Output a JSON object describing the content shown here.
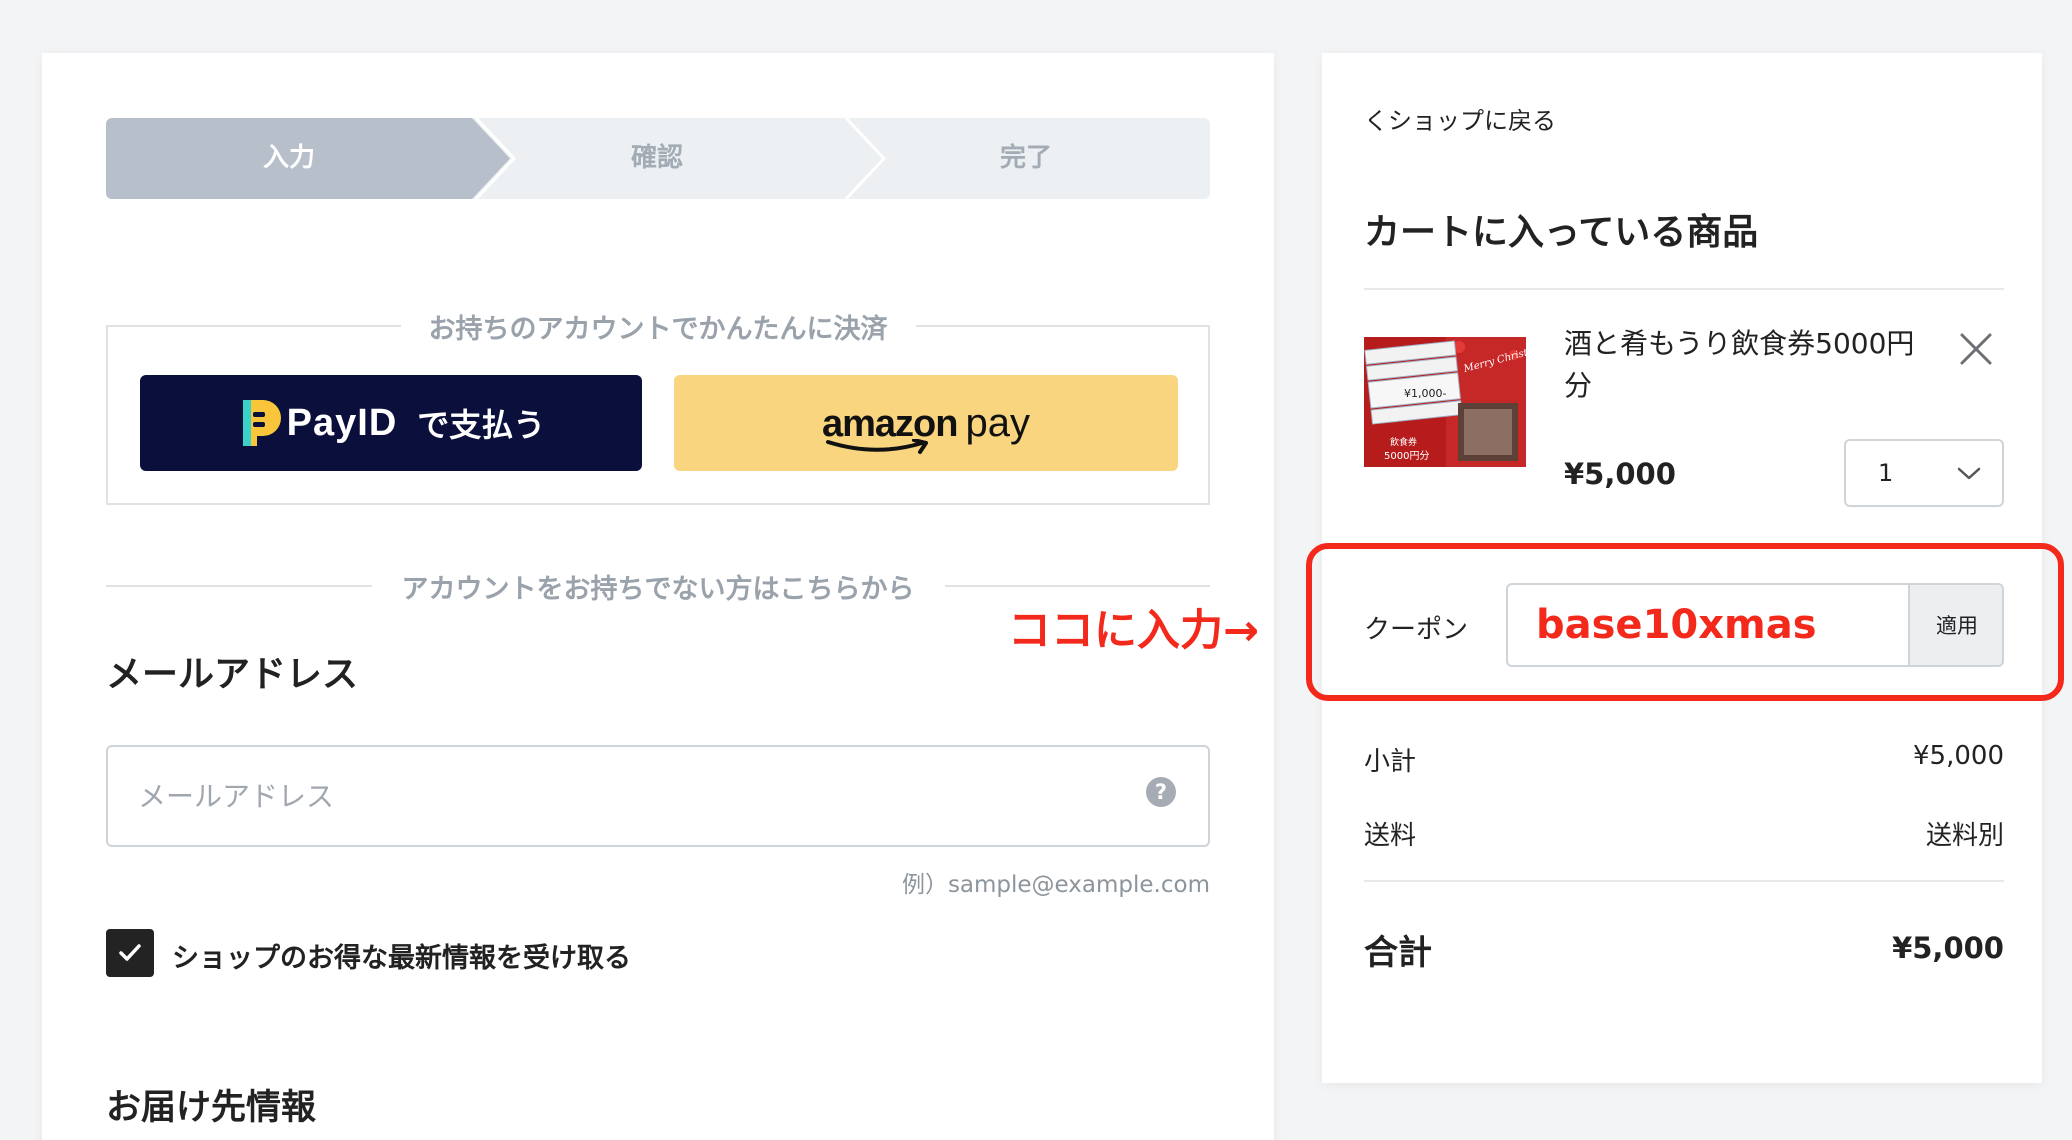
{
  "steps": [
    "入力",
    "確認",
    "完了"
  ],
  "account": {
    "legend": "お持ちのアカウントでかんたんに決済",
    "payid_brand": "PayID",
    "payid_suffix": "で支払う",
    "amazon_word": "amazon",
    "amazon_pay": "pay"
  },
  "guest": {
    "divider": "アカウントをお持ちでない方はこちらから",
    "email_label": "メールアドレス",
    "email_placeholder": "メールアドレス",
    "help_icon": "?",
    "email_example": "例）sample@example.com",
    "newsletter_label": "ショップのお得な最新情報を受け取る",
    "newsletter_checked": true,
    "delivery_label": "お届け先情報"
  },
  "annotation": "ココに入力→",
  "cart": {
    "back_link": "くショップに戻る",
    "title": "カートに入っている商品",
    "item": {
      "name": "酒と肴もうり飲食券5000円分",
      "price": "¥5,000",
      "quantity": "1",
      "image_texts": {
        "script": "Merry Christmas",
        "voucher": "¥1,000-",
        "tag1": "飲食券",
        "tag2": "5000円分"
      }
    },
    "coupon": {
      "label": "クーポン",
      "value": "base10xmas",
      "apply": "適用"
    },
    "subtotal_label": "小計",
    "subtotal_value": "¥5,000",
    "shipping_label": "送料",
    "shipping_value": "送料別",
    "total_label": "合計",
    "total_value": "¥5,000"
  },
  "colors": {
    "step_active": "#b6bfca",
    "step_inactive": "#edf0f3",
    "payid_bg": "#0b0f3b",
    "payid_logo": "#f9c53a",
    "amazon_bg": "#f8d57e",
    "highlight_red": "#f3291c"
  }
}
